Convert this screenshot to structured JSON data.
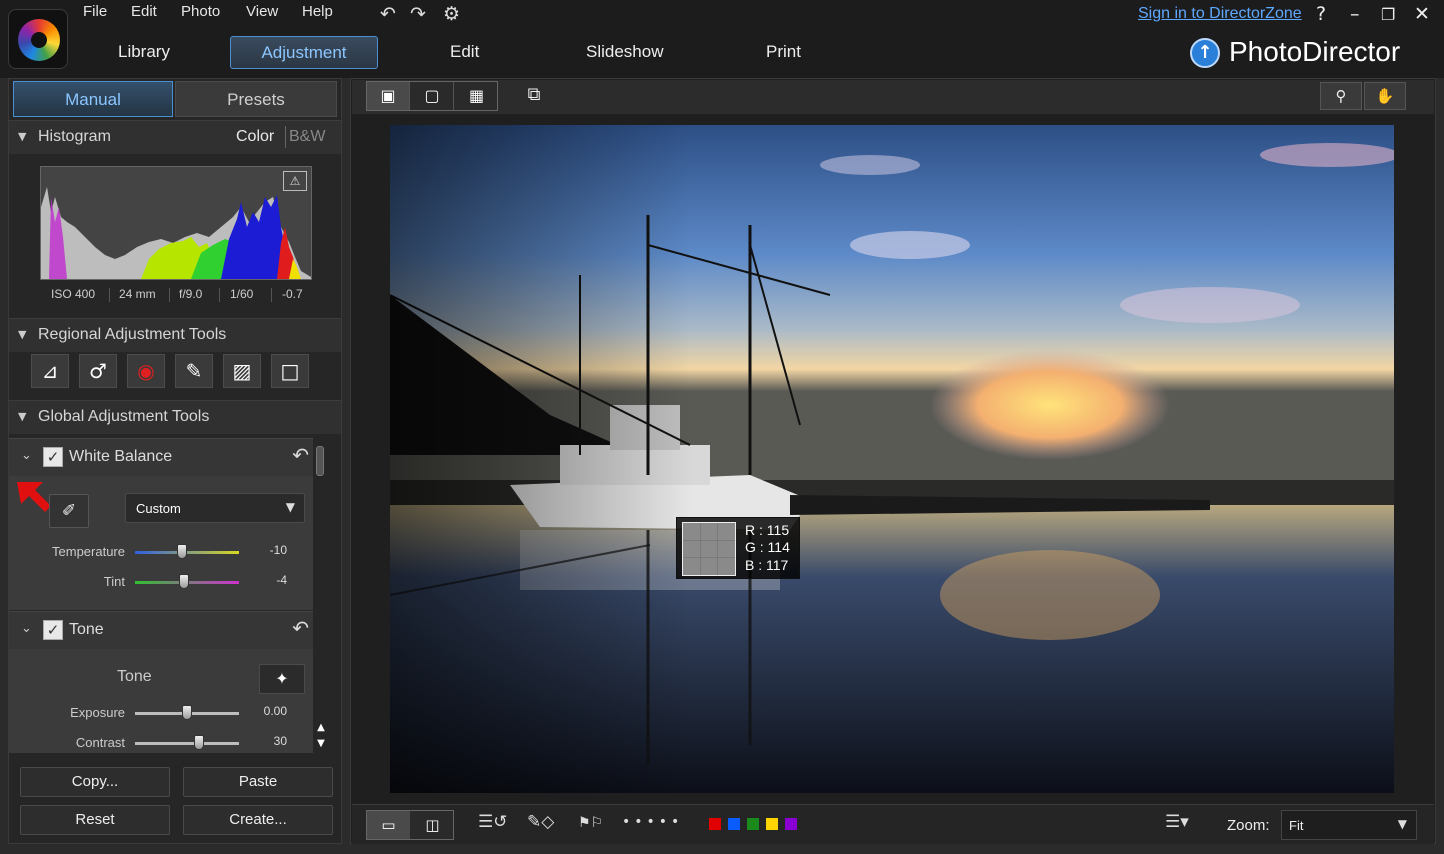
{
  "menu": [
    "File",
    "Edit",
    "Photo",
    "View",
    "Help"
  ],
  "header": {
    "sign_in": "Sign in to DirectorZone",
    "brand": "PhotoDirector",
    "modules": [
      "Library",
      "Adjustment",
      "Edit",
      "Slideshow",
      "Print"
    ],
    "active_module": "Adjustment"
  },
  "left_panel": {
    "tabs": [
      "Manual",
      "Presets"
    ],
    "histogram": {
      "title": "Histogram",
      "mode_color": "Color",
      "mode_bw": "B&W",
      "exif": [
        "ISO 400",
        "24 mm",
        "f/9.0",
        "1/60",
        "-0.7"
      ]
    },
    "regional": {
      "title": "Regional Adjustment Tools",
      "tools": [
        "crop-icon",
        "spot-removal-icon",
        "red-eye-icon",
        "brush-icon",
        "gradient-icon",
        "radial-icon"
      ]
    },
    "global": {
      "title": "Global Adjustment Tools",
      "white_balance": {
        "label": "White Balance",
        "preset": "Custom",
        "temperature_label": "Temperature",
        "temperature_value": "-10",
        "temperature_level": 0.45,
        "tint_label": "Tint",
        "tint_value": "-4",
        "tint_level": 0.47
      },
      "tone": {
        "label": "Tone",
        "sub_label": "Tone",
        "exposure_label": "Exposure",
        "exposure_value": "0.00",
        "exposure_level": 0.5,
        "contrast_label": "Contrast",
        "contrast_value": "30",
        "contrast_level": 0.62
      }
    },
    "buttons": {
      "copy": "Copy...",
      "paste": "Paste",
      "reset": "Reset",
      "create": "Create..."
    }
  },
  "viewer": {
    "rgb": {
      "r": "R : 115",
      "g": "G : 114",
      "b": "B : 117"
    },
    "label_colors": [
      "#e00000",
      "#0b5cff",
      "#1a8a1a",
      "#ffd400",
      "#8a00d4"
    ],
    "zoom_label": "Zoom:",
    "zoom_value": "Fit"
  }
}
